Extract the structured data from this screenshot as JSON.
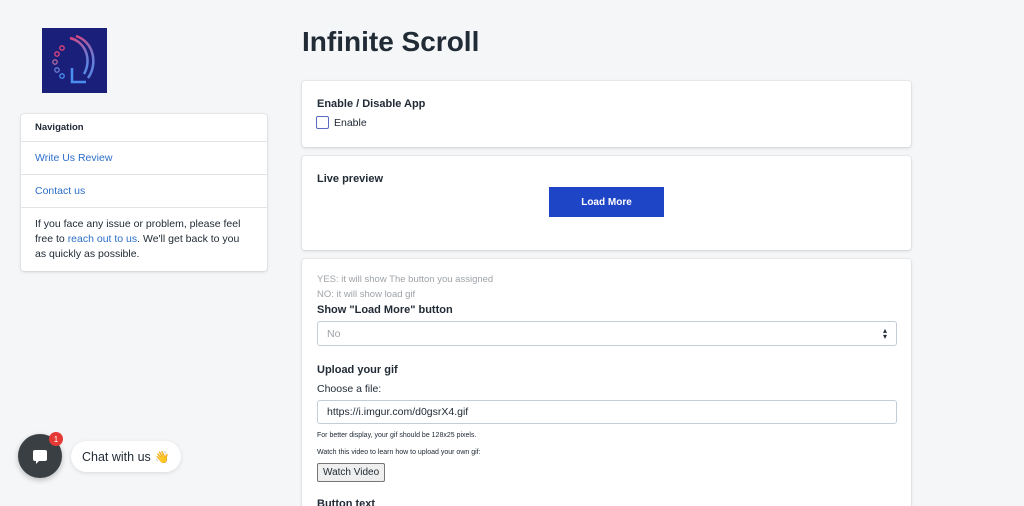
{
  "page": {
    "title": "Infinite Scroll"
  },
  "navigation": {
    "title": "Navigation",
    "links": [
      "Write Us Review",
      "Contact us"
    ],
    "help_prefix": "If you face any issue or problem, please feel free to ",
    "help_link": "reach out to us",
    "help_suffix": ". We'll get back to you as quickly as possible."
  },
  "enable_card": {
    "heading": "Enable / Disable App",
    "checkbox_label": "Enable",
    "checked": false
  },
  "preview_card": {
    "heading": "Live preview",
    "button_label": "Load More"
  },
  "settings_card": {
    "hint_yes": "YES: it will show The button you assigned",
    "hint_no": "NO: it will show load gif",
    "show_button_label": "Show \"Load More\" button",
    "show_button_value": "No",
    "upload_heading": "Upload your gif",
    "choose_file_label": "Choose a file:",
    "gif_url": "https://i.imgur.com/d0gsrX4.gif",
    "display_note": "For better display, your gif should be 128x25 pixels.",
    "video_note": "Watch this video to learn how to upload your own gif:",
    "watch_button": "Watch Video",
    "button_text_heading": "Button text"
  },
  "chat": {
    "label": "Chat with us",
    "wave": "👋",
    "badge_count": "1"
  },
  "colors": {
    "accent": "#1f45c7",
    "link": "#2c6ecb",
    "logo_bg": "#1a1f7a"
  }
}
